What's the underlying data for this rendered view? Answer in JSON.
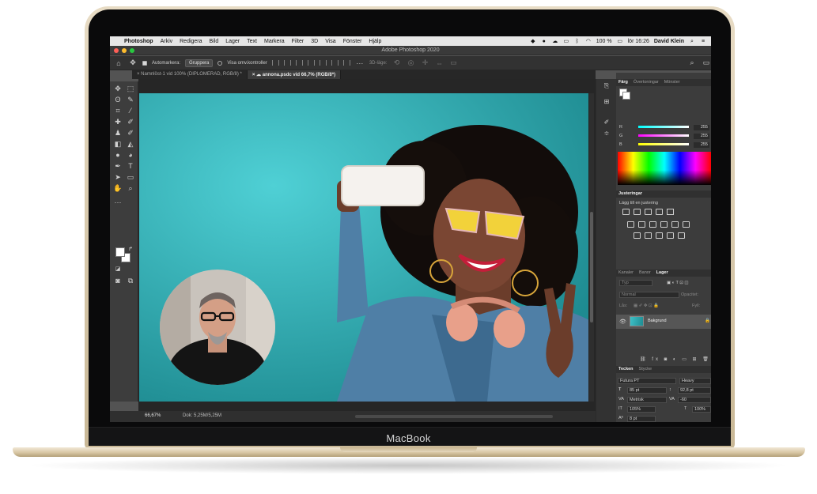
{
  "device": {
    "brand": "MacBook"
  },
  "menubar": {
    "items": [
      "Photoshop",
      "Arkiv",
      "Redigera",
      "Bild",
      "Lager",
      "Text",
      "Markera",
      "Filter",
      "3D",
      "Visa",
      "Fönster",
      "Hjälp"
    ],
    "battery": "100 %",
    "clock": "lör 16:26",
    "user": "David Klein"
  },
  "window": {
    "title": "Adobe Photoshop 2020"
  },
  "options_bar": {
    "auto_select_label": "Automarkera:",
    "auto_select_value": "Gruppera",
    "show_transform_label": "Visa omv.kontroller",
    "mode_3d_label": "3D-läge:"
  },
  "document_tabs": [
    {
      "label": "Namnlöst-1 vid 100% (DIPLOMERAD, RGB/8) *",
      "active": false
    },
    {
      "label": "annona.psdc vid 66,7% (RGB/8*)",
      "active": true
    }
  ],
  "status_bar": {
    "zoom": "66,67%",
    "doc_info": "Dok: 5,25M/5,25M"
  },
  "color_panel": {
    "tabs": [
      "Färg",
      "Övertoningar",
      "Mönster"
    ],
    "sliders": [
      {
        "label": "R",
        "value": "255"
      },
      {
        "label": "G",
        "value": "255"
      },
      {
        "label": "B",
        "value": "255"
      }
    ]
  },
  "adjustments_panel": {
    "title": "Justeringar",
    "subtitle": "Lägg till en justering"
  },
  "layers_panel": {
    "tabs": [
      "Kanaler",
      "Banor",
      "Lager"
    ],
    "search_placeholder": "Typ",
    "blend_mode": "Normal",
    "opacity_label": "Opacitet:",
    "lock_label": "Lås:",
    "fill_label": "Fyll:",
    "layer_name": "Bakgrund"
  },
  "character_panel": {
    "tabs": [
      "Tecken",
      "Stycke"
    ],
    "font_family": "Futura PT",
    "font_style": "Heavy",
    "font_size": "85 pt",
    "leading": "92,8 pt",
    "kerning": "Metrisk",
    "tracking": "-60",
    "vertical_scale": "105%",
    "horizontal_scale": "100%",
    "baseline_shift": "8 pt",
    "color_label": "Färg:",
    "style_buttons": [
      "T",
      "T",
      "TT",
      "Tr",
      "T'",
      "T,",
      "T",
      "T"
    ],
    "opentype_buttons": [
      "fi",
      "ℴ",
      "st",
      "A",
      "ad",
      "T",
      "1st",
      "½"
    ],
    "language": "Svenska",
    "antialias": "Skärpa"
  },
  "colors": {
    "backdrop": "#3ec0c7",
    "panel_bg": "#3c3c3c",
    "menubar_bg": "#e6e6e6"
  }
}
